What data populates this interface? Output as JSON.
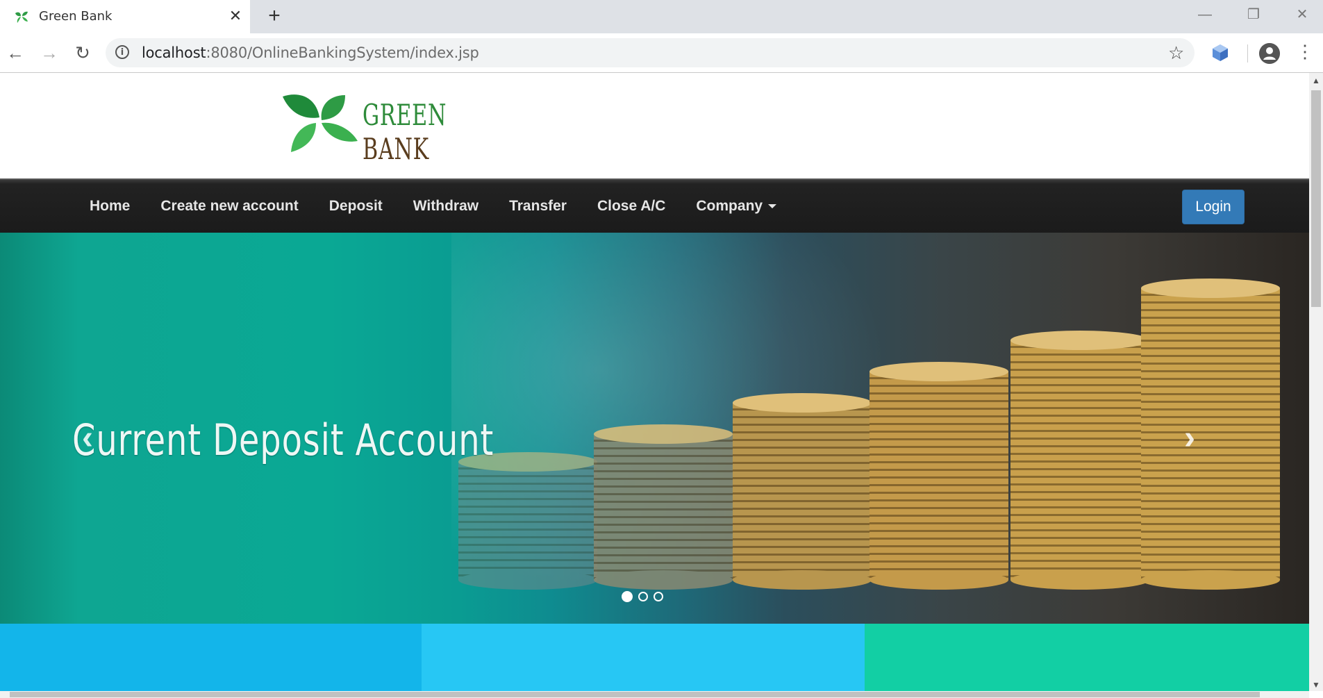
{
  "browser": {
    "tab_title": "Green Bank",
    "new_tab": "+",
    "url_host": "localhost",
    "url_rest": ":8080/OnlineBankingSystem/index.jsp"
  },
  "site": {
    "logo_word1": "GREEN",
    "logo_word2": "BANK",
    "nav": [
      "Home",
      "Create new account",
      "Deposit",
      "Withdraw",
      "Transfer",
      "Close A/C",
      "Company"
    ],
    "login": "Login"
  },
  "carousel": {
    "caption": "Current  Deposit  Account",
    "prev": "‹",
    "next": "›",
    "slides": 3,
    "active_slide": 1
  },
  "colors": {
    "block1": "#13b5ea",
    "block2": "#27c7f4",
    "block3": "#12cfa4",
    "login_bg": "#337ab7"
  }
}
